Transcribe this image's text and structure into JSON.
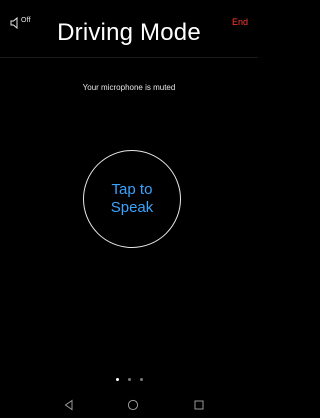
{
  "header": {
    "sound_toggle": {
      "label": "Off",
      "icon": "speaker-icon"
    },
    "title": "Driving Mode",
    "end_label": "End",
    "end_color": "#ff3b30"
  },
  "status": {
    "message": "Your microphone is muted"
  },
  "speak_button": {
    "label": "Tap to\nSpeak",
    "label_color": "#3aa3ff"
  },
  "pager": {
    "page_count": 3,
    "active_index": 0
  },
  "navbar": {
    "items": [
      {
        "icon": "back-triangle-icon"
      },
      {
        "icon": "home-circle-icon"
      },
      {
        "icon": "recents-square-icon"
      }
    ]
  }
}
